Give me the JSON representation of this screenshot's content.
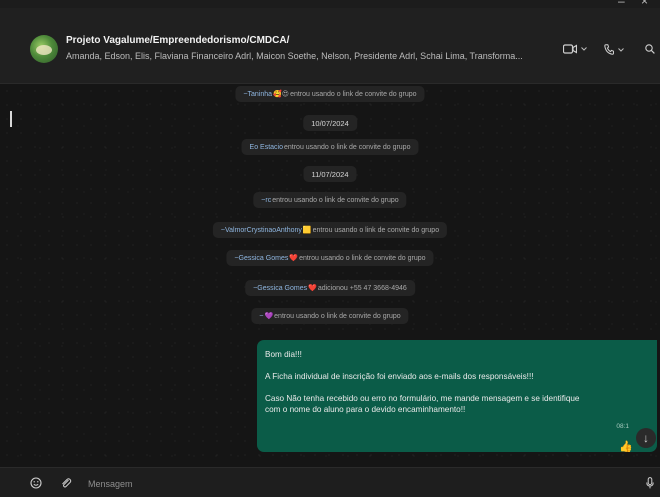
{
  "window": {
    "close_glyph": "×"
  },
  "header": {
    "title": "Projeto Vagalume/Empreendedorismo/CMDCA/",
    "members": "Amanda, Edson, Elis, Flaviana Financeiro Adrl, Maicon Soethe, Nelson, Presidente Adrl, Schai Lima, Transforma...",
    "video_icon": "video-camera-icon",
    "call_icon": "phone-icon",
    "search_icon": "search-icon"
  },
  "messages": {
    "sys1": {
      "name": "~Taninha",
      "emoji": "🥰😍",
      "text": " entrou usando o link de convite do grupo"
    },
    "date1": "10/07/2024",
    "sys2": {
      "name": "Eo Estacio",
      "text": " entrou usando o link de convite do grupo"
    },
    "date2": "11/07/2024",
    "sys3": {
      "name": "~rc",
      "text": " entrou usando o link de convite do grupo"
    },
    "sys4": {
      "name": "~ValmorCrystinaoAnthony",
      "emoji": "🟨",
      "text": " entrou usando o link de convite do grupo"
    },
    "sys5": {
      "name": "~Gessica Gomes",
      "emoji": "❤️",
      "text": " entrou usando o link de convite do grupo"
    },
    "sys6": {
      "name": "~Gessica Gomes",
      "emoji": "❤️",
      "text": " adicionou +55 47 3668-4946"
    },
    "sys7": {
      "name": "~",
      "emoji": "💜",
      "text": " entrou usando o link de convite do grupo"
    },
    "bubble": {
      "line1": "Bom dia!!!",
      "line2": "A Ficha individual de inscrição foi enviado aos e-mails dos responsáveis!!!",
      "line3": "Caso Não tenha recebido ou erro no formulário, me mande mensagem e se identifique",
      "line4": "com o nome do aluno para o devido encaminhamento!!",
      "time": "08:1",
      "reaction": "👍"
    }
  },
  "footer": {
    "placeholder": "Mensagem"
  }
}
